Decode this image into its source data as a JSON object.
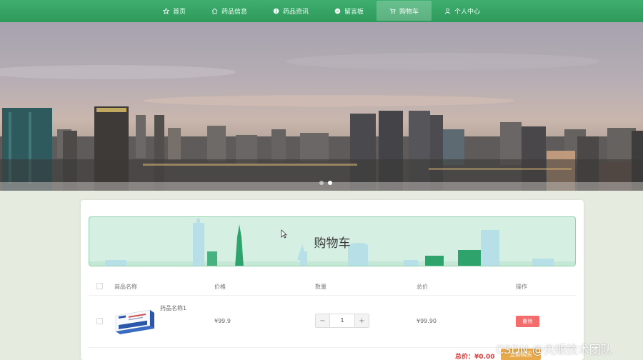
{
  "nav": {
    "items": [
      {
        "label": "首页",
        "icon": "star-icon",
        "active": false
      },
      {
        "label": "药品信息",
        "icon": "home-icon",
        "active": false
      },
      {
        "label": "药品资讯",
        "icon": "info-circle-icon",
        "active": false
      },
      {
        "label": "留言板",
        "icon": "message-circle-icon",
        "active": false
      },
      {
        "label": "购物车",
        "icon": "cart-icon",
        "active": true
      },
      {
        "label": "个人中心",
        "icon": "user-icon",
        "active": false
      }
    ],
    "accent": "#35a464"
  },
  "carousel": {
    "slides": 2,
    "active_index": 1
  },
  "cart": {
    "title": "购物车",
    "columns": [
      "商品名称",
      "价格",
      "数量",
      "总价",
      "操作"
    ],
    "items": [
      {
        "name": "药品名称1",
        "price": "¥99.9",
        "quantity": "1",
        "total": "¥99.90",
        "delete_label": "删除",
        "image": "medicine-box-image"
      }
    ],
    "total_label": "总价：",
    "total_value": "¥0.00",
    "buy_label": "立即购买"
  },
  "watermark": "CSDN @央顺技术团队",
  "colors": {
    "delete": "#f56c6c",
    "buy": "#e8a94a",
    "total": "#e03a3a",
    "banner_bg": "#d5efe3"
  }
}
